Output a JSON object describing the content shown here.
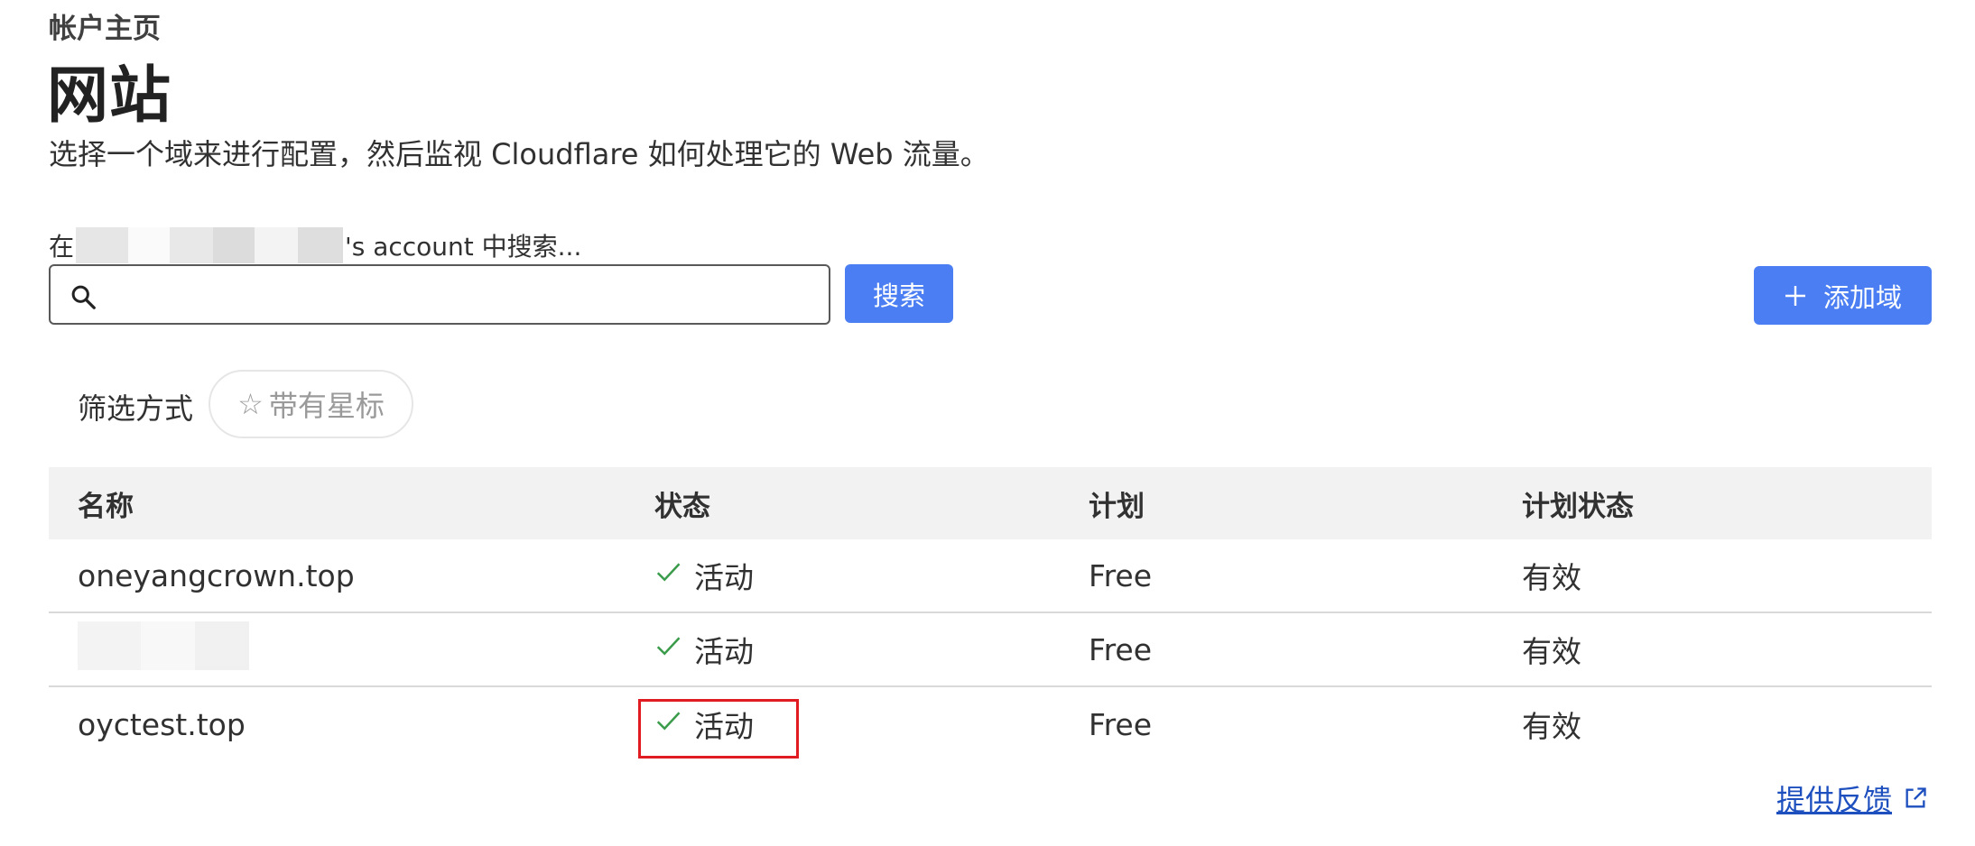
{
  "header": {
    "breadcrumb": "帐户主页",
    "title": "网站",
    "subtitle": "选择一个域来进行配置，然后监视 Cloudflare 如何处理它的 Web 流量。"
  },
  "search": {
    "label_prefix": "在",
    "label_suffix": "'s account 中搜索...",
    "placeholder": "",
    "value": "",
    "button_label": "搜索"
  },
  "add_domain_label": "添加域",
  "filter": {
    "label": "筛选方式",
    "star_label": "带有星标"
  },
  "table": {
    "headers": [
      "名称",
      "状态",
      "计划",
      "计划状态"
    ],
    "rows": [
      {
        "name": "oneyangcrown.top",
        "status": "活动",
        "plan": "Free",
        "plan_status": "有效"
      },
      {
        "name": "",
        "status": "活动",
        "plan": "Free",
        "plan_status": "有效"
      },
      {
        "name": "oyctest.top",
        "status": "活动",
        "plan": "Free",
        "plan_status": "有效"
      }
    ]
  },
  "feedback_label": "提供反馈",
  "colors": {
    "accent": "#4a7ef2",
    "check": "#3a9b4a",
    "highlight": "#e01b22",
    "link": "#1d4fbf"
  },
  "icons": [
    "search-icon",
    "plus-icon",
    "star-icon",
    "check-icon",
    "external-link-icon"
  ]
}
